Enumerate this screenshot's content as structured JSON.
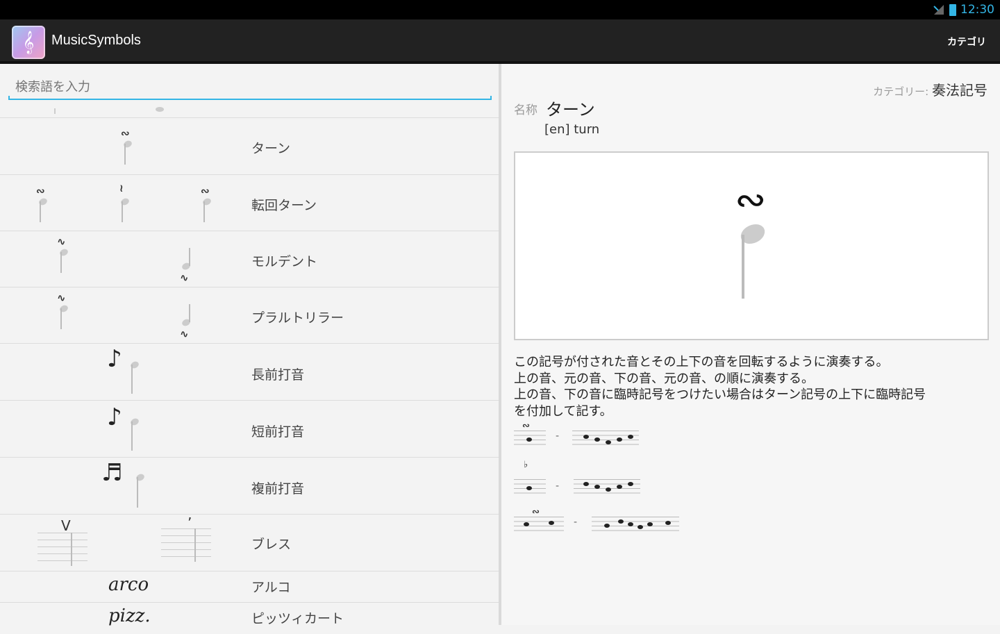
{
  "status": {
    "time": "12:30"
  },
  "appbar": {
    "title": "MusicSymbols",
    "category_button": "カテゴリ",
    "icon_glyph": "𝄞"
  },
  "search": {
    "placeholder": "検索語を入力"
  },
  "list": [
    {
      "label": "ターン",
      "ornaments": [
        "∾"
      ]
    },
    {
      "label": "転回ターン",
      "ornaments": [
        "∾",
        "≀",
        "∾"
      ]
    },
    {
      "label": "モルデント",
      "ornaments": [
        "∿",
        "∿"
      ]
    },
    {
      "label": "プラルトリラー",
      "ornaments": [
        "∿",
        "∿"
      ]
    },
    {
      "label": "長前打音",
      "ornaments": [
        "♪"
      ]
    },
    {
      "label": "短前打音",
      "ornaments": [
        "♪"
      ]
    },
    {
      "label": "複前打音",
      "ornaments": [
        "♬"
      ]
    },
    {
      "label": "ブレス",
      "ornaments": [
        "V",
        "’"
      ]
    },
    {
      "label": "アルコ",
      "text": "arco"
    },
    {
      "label": "ピッツィカート",
      "text": "pizz."
    }
  ],
  "detail": {
    "category_prefix": "カテゴリー:",
    "category": "奏法記号",
    "name_label": "名称",
    "name": "ターン",
    "english": "[en] turn",
    "big_ornament": "∾",
    "description": [
      "この記号が付された音とその上下の音を回転するように演奏する。",
      "上の音、元の音、下の音、元の音、の順に演奏する。",
      "上の音、下の音に臨時記号をつけたい場合はターン記号の上下に臨時記号",
      "を付加して記す。"
    ],
    "examples": [
      {
        "symbol": "∾",
        "dash": "-"
      },
      {
        "symbol": "♭",
        "dash": "-"
      },
      {
        "symbol": "∾",
        "dash": "-"
      }
    ]
  }
}
